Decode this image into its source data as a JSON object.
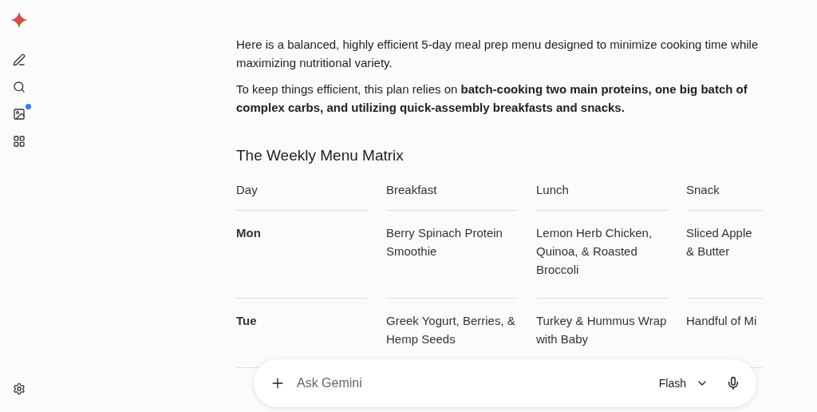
{
  "sidebar": {
    "items": [
      {
        "kind": "edit",
        "notify": false
      },
      {
        "kind": "search",
        "notify": false
      },
      {
        "kind": "gallery",
        "notify": true
      },
      {
        "kind": "apps",
        "notify": false
      }
    ],
    "bottom": {
      "kind": "settings"
    }
  },
  "response": {
    "paragraphs": [
      "Here is a balanced, highly efficient 5-day meal prep menu designed to minimize cooking time while maximizing nutritional variety.",
      "To keep things efficient, this plan relies on **batch-cooking two main proteins, one big batch of complex carbs, and utilizing quick-assembly breakfasts and snacks.**"
    ],
    "heading": "The Weekly Menu Matrix",
    "table": {
      "columns": [
        "Day",
        "Breakfast",
        "Lunch",
        "Snack"
      ],
      "rows": [
        [
          "Mon",
          "Berry Spinach Protein Smoothie",
          "Lemon Herb Chicken, Quinoa, & Roasted Broccoli",
          "Sliced Apple & Butter"
        ],
        [
          "Tue",
          "Greek Yogurt, Berries, & Hemp Seeds",
          "Turkey & Hummus Wrap with Baby",
          "Handful of Mi"
        ]
      ]
    }
  },
  "composer": {
    "placeholder": "Ask Gemini",
    "model": "Flash"
  }
}
